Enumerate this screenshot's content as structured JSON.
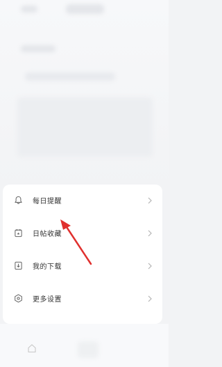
{
  "menu": {
    "items": [
      {
        "label": "每日提醒",
        "icon": "bell-icon"
      },
      {
        "label": "日帖收藏",
        "icon": "calendar-icon"
      },
      {
        "label": "我的下载",
        "icon": "download-icon"
      },
      {
        "label": "更多设置",
        "icon": "settings-hexagon-icon"
      }
    ]
  },
  "annotation": {
    "color": "#e0302e"
  },
  "colors": {
    "text": "#333333",
    "icon": "#666666",
    "chevron": "#b5b5b5",
    "background": "#f2f3f5"
  }
}
